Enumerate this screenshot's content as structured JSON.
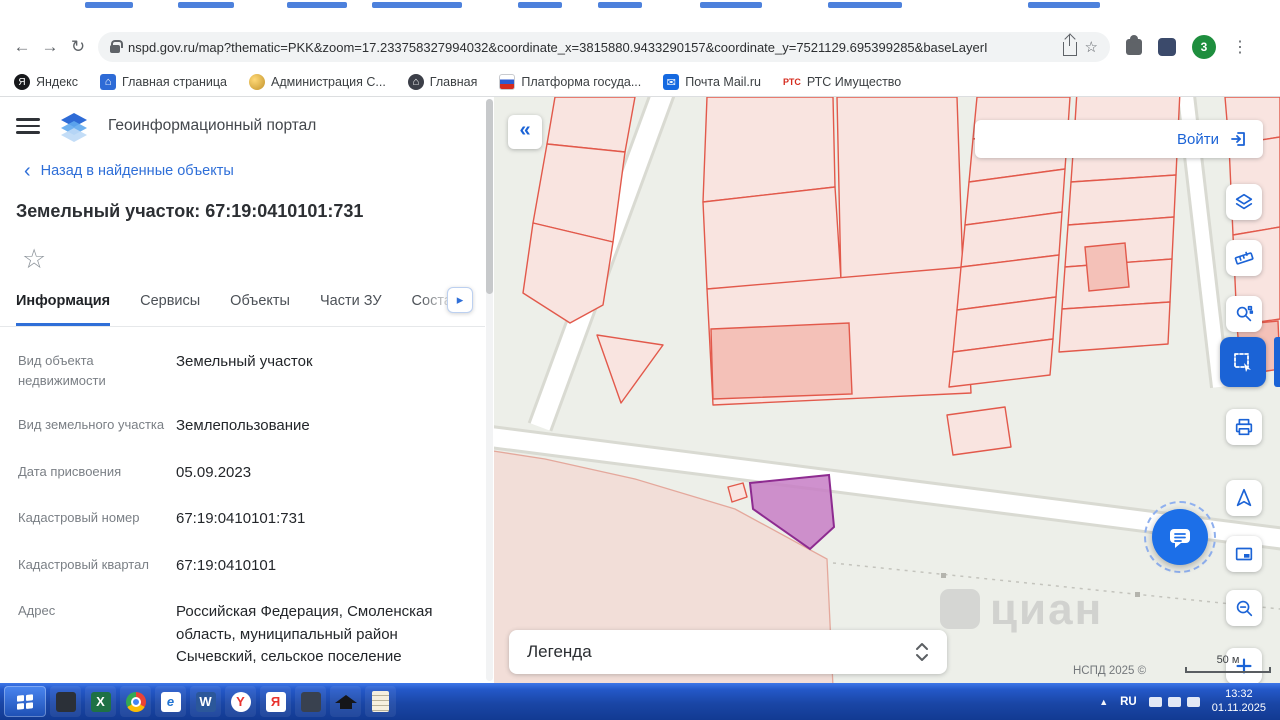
{
  "browser": {
    "url": "nspd.gov.ru/map?thematic=PKK&zoom=17.233758327994032&coordinate_x=3815880.9433290157&coordinate_y=7521129.695399285&baseLayerI",
    "profile_badge": "3",
    "bookmarks": [
      {
        "label": "Яндекс",
        "icon_text": "Я"
      },
      {
        "label": "Главная страница",
        "icon_text": "⌂"
      },
      {
        "label": "Администрация С...",
        "icon_text": ""
      },
      {
        "label": "Главная",
        "icon_text": "⌂"
      },
      {
        "label": "Платформа госуда...",
        "icon_text": ""
      },
      {
        "label": "Почта Mail.ru",
        "icon_text": "✉"
      },
      {
        "label": "РТС Имущество",
        "icon_text": "РТС"
      }
    ]
  },
  "panel": {
    "app_title": "Геоинформационный портал",
    "back_link": "Назад в найденные объекты",
    "title": "Земельный участок: 67:19:0410101:731",
    "tabs": [
      {
        "label": "Информация"
      },
      {
        "label": "Сервисы"
      },
      {
        "label": "Объекты"
      },
      {
        "label": "Части ЗУ"
      },
      {
        "label": "Соста"
      }
    ],
    "fields": [
      {
        "label": "Вид объекта недвижимости",
        "value": "Земельный участок"
      },
      {
        "label": "Вид земельного участка",
        "value": "Землепользование"
      },
      {
        "label": "Дата присвоения",
        "value": "05.09.2023"
      },
      {
        "label": "Кадастровый номер",
        "value": "67:19:0410101:731"
      },
      {
        "label": "Кадастровый квартал",
        "value": "67:19:0410101"
      },
      {
        "label": "Адрес",
        "value": "Российская Федерация, Смоленская область, муниципальный район Сычевский, сельское поселение"
      }
    ]
  },
  "map": {
    "login_label": "Войти",
    "legend_label": "Легенда",
    "attribution": "НСПД 2025 ©",
    "scale_label": "50 м",
    "watermark": "циан",
    "colors": {
      "accent": "#1b63d6",
      "parcel_fill": "#f9e4e0",
      "parcel_stroke": "#e2594b",
      "selected_fill": "#c77ec5",
      "selected_stroke": "#8d2b90"
    }
  },
  "taskbar": {
    "language": "RU",
    "time": "13:32",
    "date": "01.11.2025",
    "icon_glyphs": {
      "excel": "X",
      "ie": "e",
      "word": "W",
      "yandex_browser": "Y",
      "yandex": "Я"
    }
  },
  "glyphs": {
    "back_arrow": "←",
    "forward_arrow": "→",
    "reload": "↻",
    "bookmark_star": "☆",
    "kebab": "⋮",
    "collapse": "«",
    "back_chevron": "‹",
    "tabs_more": "▸",
    "favorite_star": "☆",
    "tray_up": "▲"
  }
}
